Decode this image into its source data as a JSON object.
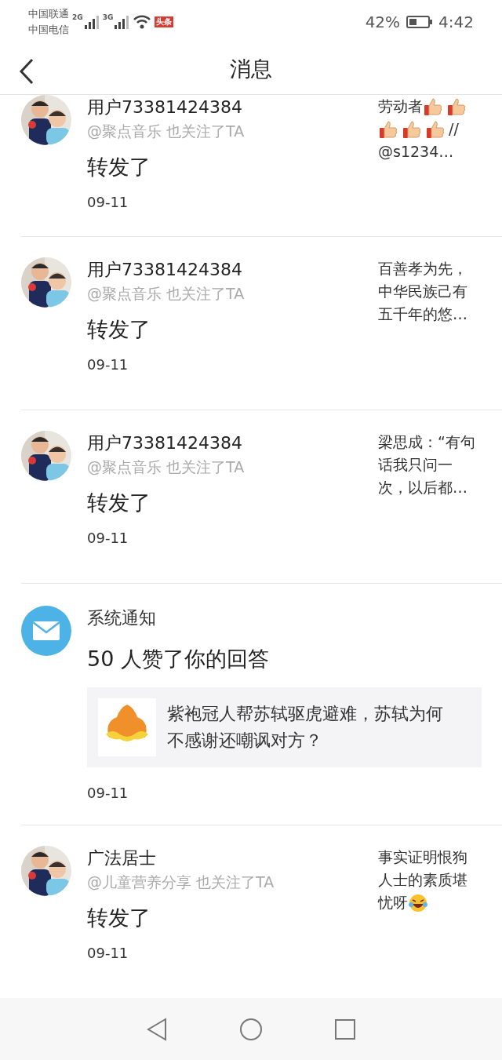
{
  "status_bar": {
    "carriers": [
      "中国联通",
      "中国电信"
    ],
    "signals": [
      {
        "label": "2G"
      },
      {
        "label": "3G"
      }
    ],
    "app_badge": "头条",
    "battery_percent": "42%",
    "time": "4:42"
  },
  "header": {
    "title": "消息"
  },
  "messages": [
    {
      "kind": "follow",
      "name": "用户73381424384",
      "subtitle": "@聚点音乐 也关注了TA",
      "action": "转发了",
      "date": "09-11",
      "preview": [
        [
          {
            "kind": "text",
            "text": "劳动者"
          },
          {
            "kind": "thumbs"
          },
          {
            "kind": "thumbs"
          }
        ],
        [
          {
            "kind": "thumbs"
          },
          {
            "kind": "thumbs"
          },
          {
            "kind": "thumbs"
          },
          {
            "kind": "text",
            "text": "//"
          }
        ],
        [
          {
            "kind": "text",
            "text": "@s1234…"
          }
        ]
      ]
    },
    {
      "kind": "follow",
      "name": "用户73381424384",
      "subtitle": "@聚点音乐 也关注了TA",
      "action": "转发了",
      "date": "09-11",
      "preview": [
        [
          {
            "kind": "text",
            "text": "百善孝为先，中华民族己有五千年的悠…"
          }
        ]
      ]
    },
    {
      "kind": "follow",
      "name": "用户73381424384",
      "subtitle": "@聚点音乐 也关注了TA",
      "action": "转发了",
      "date": "09-11",
      "preview": [
        [
          {
            "kind": "text",
            "text": "梁思成：“有句话我只问一次，以后都…"
          }
        ]
      ]
    },
    {
      "kind": "system",
      "name": "系统通知",
      "action": "50 人赞了你的回答",
      "date": "09-11",
      "card": {
        "text": "紫袍冠人帮苏轼驱虎避难，苏轼为何不感谢还嘲讽对方？"
      }
    },
    {
      "kind": "follow",
      "name": "广法居士",
      "subtitle": "@儿童营养分享 也关注了TA",
      "action": "转发了",
      "date": "09-11",
      "preview": [
        [
          {
            "kind": "text",
            "text": "事实证明恨狗人士的素质堪"
          }
        ],
        [
          {
            "kind": "text",
            "text": "忧呀"
          },
          {
            "kind": "laugh"
          }
        ]
      ]
    }
  ]
}
